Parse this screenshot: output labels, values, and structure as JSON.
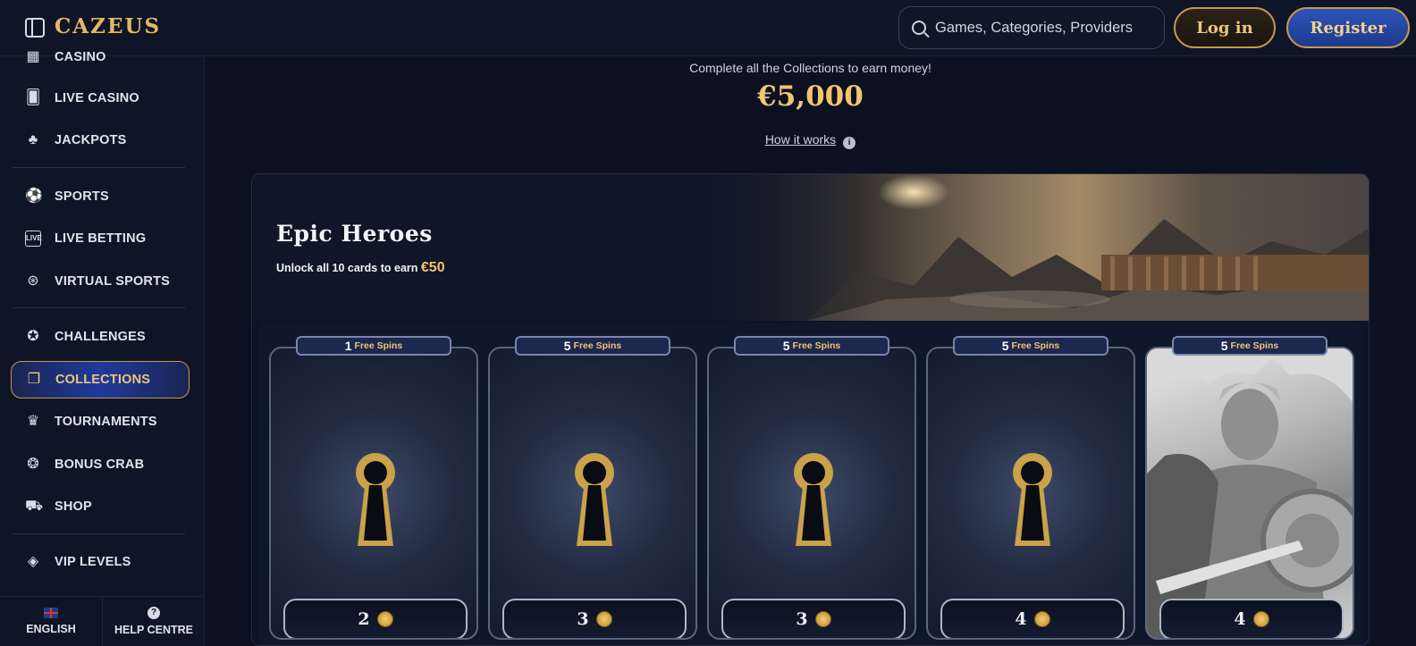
{
  "header": {
    "logo_text": "CAZEUS",
    "search_placeholder": "Games, Categories, Providers",
    "login_label": "Log in",
    "register_label": "Register"
  },
  "sidebar": {
    "items": [
      {
        "label": "CASINO",
        "icon": "casino-icon"
      },
      {
        "label": "LIVE CASINO",
        "icon": "playing-card-icon"
      },
      {
        "label": "JACKPOTS",
        "icon": "clover-icon"
      },
      {
        "label": "SPORTS",
        "icon": "soccer-ball-icon"
      },
      {
        "label": "LIVE BETTING",
        "icon": "live-tv-icon"
      },
      {
        "label": "VIRTUAL SPORTS",
        "icon": "gamepad-icon"
      },
      {
        "label": "CHALLENGES",
        "icon": "medal-icon"
      },
      {
        "label": "COLLECTIONS",
        "icon": "cards-icon",
        "active": true
      },
      {
        "label": "TOURNAMENTS",
        "icon": "trophy-icon"
      },
      {
        "label": "BONUS CRAB",
        "icon": "crab-claw-icon"
      },
      {
        "label": "SHOP",
        "icon": "cart-icon"
      },
      {
        "label": "VIP LEVELS",
        "icon": "diamond-icon"
      }
    ],
    "language_label": "ENGLISH",
    "help_label": "HELP CENTRE"
  },
  "main": {
    "intro_text": "Complete all the Collections to earn money!",
    "total_prize": "€5,000",
    "how_it_works_label": "How it works"
  },
  "collection": {
    "title": "Epic Heroes",
    "subtitle": "Unlock all 10 cards to earn",
    "reward": "€50",
    "cards": [
      {
        "spins": "1",
        "spins_label": "Free Spins",
        "cost": "2",
        "state": "locked"
      },
      {
        "spins": "5",
        "spins_label": "Free Spins",
        "cost": "3",
        "state": "locked"
      },
      {
        "spins": "5",
        "spins_label": "Free Spins",
        "cost": "3",
        "state": "locked"
      },
      {
        "spins": "5",
        "spins_label": "Free Spins",
        "cost": "4",
        "state": "locked"
      },
      {
        "spins": "5",
        "spins_label": "Free Spins",
        "cost": "4",
        "state": "revealed"
      }
    ]
  },
  "colors": {
    "background": "#0b1120",
    "gold_accent": "#f2c46e",
    "active_blue": "#1f3a9c"
  }
}
